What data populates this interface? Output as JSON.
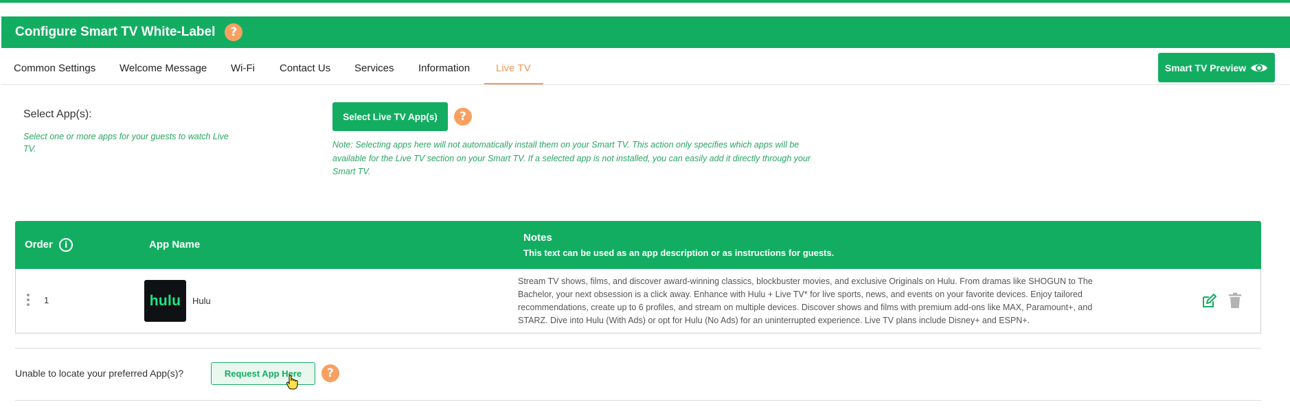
{
  "header": {
    "title": "Configure Smart TV White-Label",
    "help": "?"
  },
  "tabs": [
    {
      "label": "Common Settings"
    },
    {
      "label": "Welcome Message"
    },
    {
      "label": "Wi-Fi"
    },
    {
      "label": "Contact Us"
    },
    {
      "label": "Services"
    },
    {
      "label": "Information"
    },
    {
      "label": "Live TV",
      "active": true
    }
  ],
  "preview_button": {
    "label": "Smart TV Preview",
    "icon": "eye-icon"
  },
  "select_apps": {
    "label": "Select App(s):",
    "hint": "Select one or more apps for your guests to watch Live TV.",
    "button_label": "Select Live TV App(s)",
    "help": "?",
    "note": "Note: Selecting apps here will not automatically install them on your Smart TV. This action only specifies which apps will be available for the Live TV section on your Smart TV. If a selected app is not installed, you can easily add it directly through your Smart TV."
  },
  "table": {
    "headers": {
      "order": "Order",
      "order_info": "i",
      "app_name": "App Name",
      "notes": "Notes",
      "notes_sub": "This text can be used as an app description or as instructions for guests."
    },
    "rows": [
      {
        "order": "1",
        "logo_text": "hulu",
        "app_name": "Hulu",
        "notes": "Stream TV shows, films, and discover award-winning classics, blockbuster movies, and exclusive Originals on Hulu. From dramas like SHOGUN to The Bachelor, your next obsession is a click away. Enhance with Hulu + Live TV* for live sports, news, and events on your favorite devices. Enjoy tailored recommendations, create up to 6 profiles, and stream on multiple devices. Discover shows and films with premium add-ons like MAX, Paramount+, and STARZ. Dive into Hulu (With Ads) or opt for Hulu (No Ads) for an uninterrupted experience. Live TV plans include Disney+ and ESPN+."
      }
    ]
  },
  "request": {
    "label": "Unable to locate your preferred App(s)?",
    "button_label": "Request App Here",
    "help": "?"
  },
  "colors": {
    "primary": "#13ad62",
    "accent": "#f29a5d",
    "help_badge": "#f7a062"
  }
}
